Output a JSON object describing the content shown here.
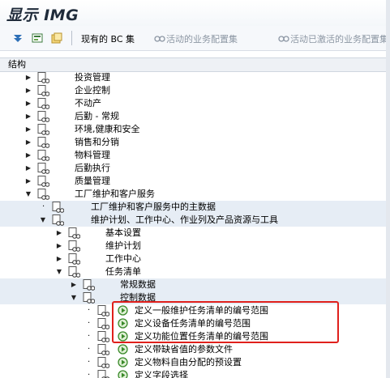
{
  "app": {
    "title": "显示 IMG"
  },
  "toolbar": {
    "current_bc_set": "现有的 BC 集",
    "active_config_set": "活动的业务配置集",
    "active_config_activated": "活动已激活的业务配置集"
  },
  "structure": {
    "header": "结构",
    "rows": [
      {
        "label": "投资管理"
      },
      {
        "label": "企业控制"
      },
      {
        "label": "不动产"
      },
      {
        "label": "后勤 - 常规"
      },
      {
        "label": "环境,健康和安全"
      },
      {
        "label": "销售和分销"
      },
      {
        "label": "物料管理"
      },
      {
        "label": "后勤执行"
      },
      {
        "label": "质量管理"
      },
      {
        "label": "工厂维护和客户服务"
      },
      {
        "label": "工厂维护和客户服务中的主数据"
      },
      {
        "label": "维护计划、工作中心、作业列及产品资源与工具"
      },
      {
        "label": "基本设置"
      },
      {
        "label": "维护计划"
      },
      {
        "label": "工作中心"
      },
      {
        "label": "任务清单"
      },
      {
        "label": "常规数据"
      },
      {
        "label": "控制数据"
      },
      {
        "label": "定义一般维护任务清单的编号范围"
      },
      {
        "label": "定义设备任务清单的编号范围"
      },
      {
        "label": "定义功能位置任务清单的编号范围"
      },
      {
        "label": "定义带缺省值的参数文件"
      },
      {
        "label": "定义物料自由分配的预设置"
      },
      {
        "label": "定义字段选择"
      }
    ]
  }
}
